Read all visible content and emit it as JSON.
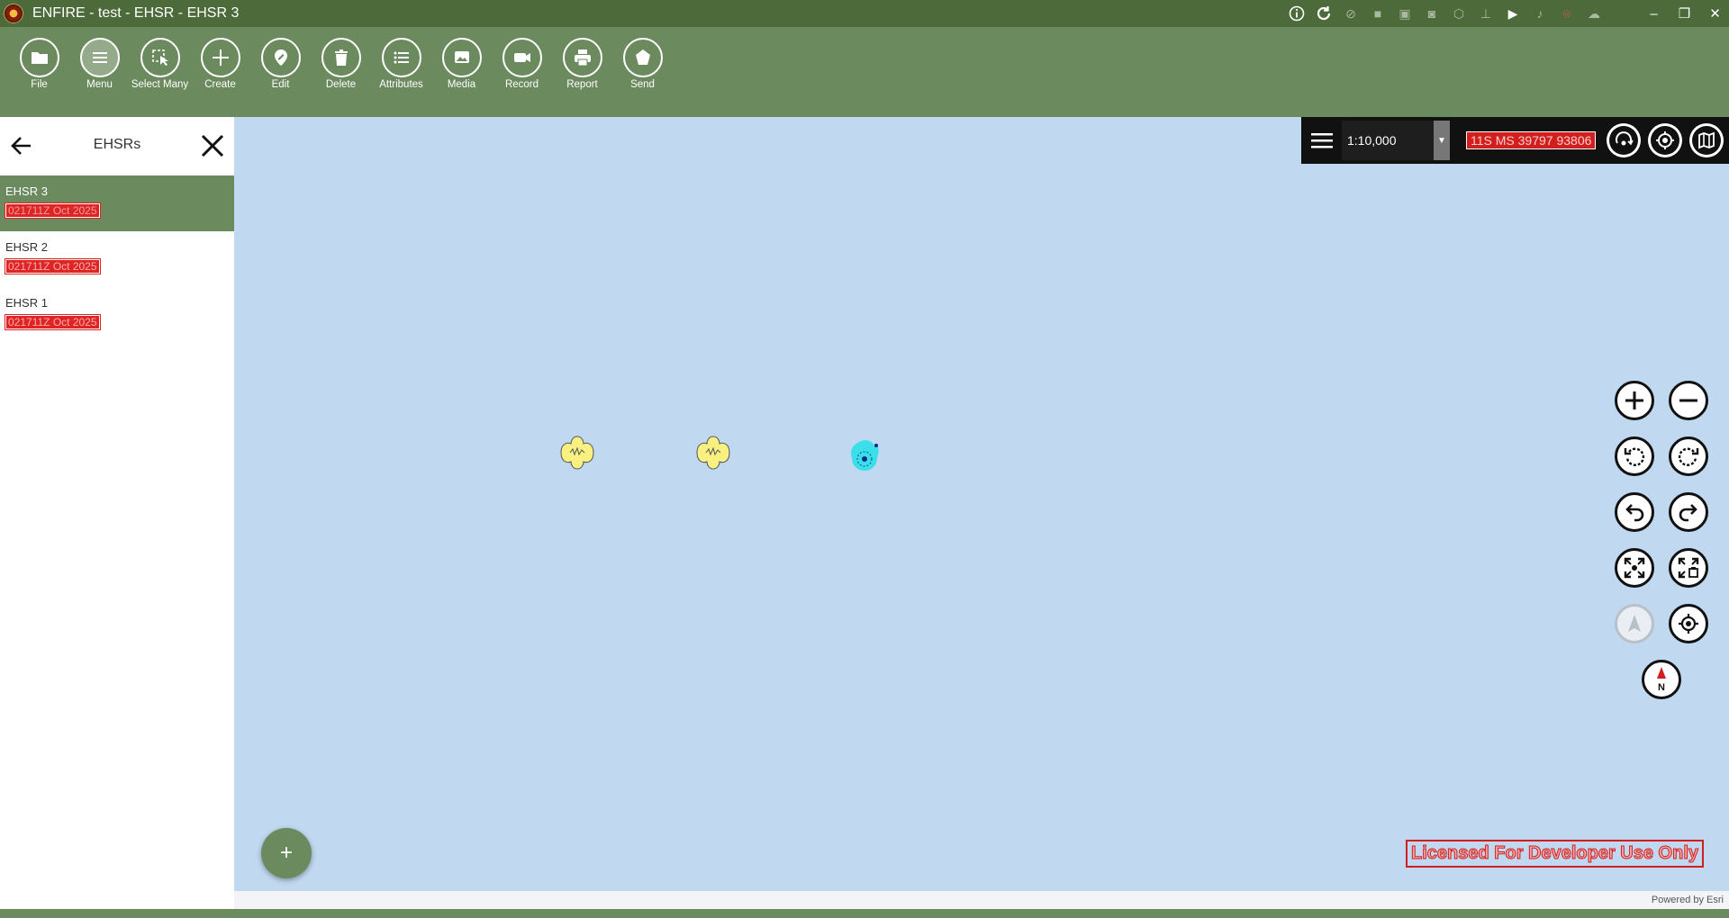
{
  "window": {
    "title": "ENFIRE - test - EHSR - EHSR 3",
    "status_icons": [
      "info-icon",
      "refresh-icon",
      "satellite-icon",
      "video-icon",
      "camera-icon",
      "binoculars-icon",
      "cube-icon",
      "axes-icon",
      "camcorder-icon",
      "microphone-icon",
      "wifi-alert-icon",
      "cloud-icon"
    ],
    "controls": {
      "minimize": "–",
      "restore": "❐",
      "close": "✕"
    }
  },
  "toolbar": {
    "items": [
      {
        "label": "File",
        "icon": "folder-icon"
      },
      {
        "label": "Menu",
        "icon": "menu-icon"
      },
      {
        "label": "Select Many",
        "icon": "select-many-icon"
      },
      {
        "label": "Create",
        "icon": "plus-icon"
      },
      {
        "label": "Edit",
        "icon": "pin-edit-icon"
      },
      {
        "label": "Delete",
        "icon": "trash-icon"
      },
      {
        "label": "Attributes",
        "icon": "list-icon"
      },
      {
        "label": "Media",
        "icon": "images-icon"
      },
      {
        "label": "Record",
        "icon": "video-camera-icon"
      },
      {
        "label": "Report",
        "icon": "printer-icon"
      },
      {
        "label": "Send",
        "icon": "send-icon"
      }
    ],
    "active_item": "Menu"
  },
  "sidepanel": {
    "title": "EHSRs",
    "items": [
      {
        "name": "EHSR 3",
        "time": "021711Z Oct 2025",
        "selected": true
      },
      {
        "name": "EHSR 2",
        "time": "021711Z Oct 2025",
        "selected": false
      },
      {
        "name": "EHSR 1",
        "time": "021711Z Oct 2025",
        "selected": false
      }
    ]
  },
  "map": {
    "scale": "1:10,000",
    "coordinate": "11S MS 39797 93806",
    "top_buttons": [
      "orbit-icon",
      "gps-target-icon",
      "basemap-icon"
    ],
    "nav_buttons": [
      "zoom-in-icon",
      "zoom-out-icon",
      "rotate-left-icon",
      "rotate-right-icon",
      "undo-icon",
      "redo-icon",
      "full-extent-icon",
      "zoom-extent-icon",
      "navigation-arrow-icon",
      "locate-icon",
      "north-arrow-icon"
    ],
    "north_label": "N",
    "fab_label": "+",
    "license_text": "Licensed For Developer Use Only",
    "attribution": "Powered by Esri"
  },
  "colors": {
    "titlebar": "#4d6a3a",
    "toolbar": "#6b8a5e",
    "map_background": "#c0d8f0",
    "highlight_red": "#d31e1e",
    "symbol_yellow": "#f8f080",
    "selection_cyan": "#22e0e8"
  }
}
